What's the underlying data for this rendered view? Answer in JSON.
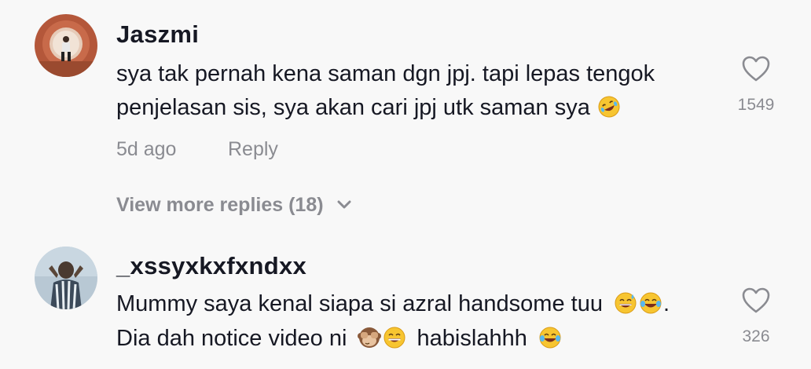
{
  "comments": [
    {
      "username": "Jaszmi",
      "lines": [
        "sya tak pernah kena saman dgn jpj. tapi lepas tengok",
        "penjelasan sis, sya akan cari jpj utk saman sya"
      ],
      "line2_emoji": "rolling-on-floor-laughing-emoji",
      "time": "5d ago",
      "reply_label": "Reply",
      "likes": "1549",
      "view_more": "View more replies (18)"
    },
    {
      "username": "_xssyxkxfxndxx",
      "line1_text": "Mummy saya kenal siapa si azral handsome tuu",
      "line1_emojis": [
        "grinning-sweat-emoji",
        "tears-of-joy-emoji"
      ],
      "line1_after": ".",
      "line2_text": "Dia dah notice video ni",
      "line2_emojis": [
        "see-no-evil-monkey-emoji",
        "grinning-squinting-emoji"
      ],
      "line2_after": "habislahhh",
      "line2_end_emoji": "tears-of-joy-emoji",
      "likes": "326"
    }
  ],
  "colors": {
    "background": "#f8f8f8",
    "primary_text": "#161823",
    "secondary_text": "#8a8b91"
  }
}
